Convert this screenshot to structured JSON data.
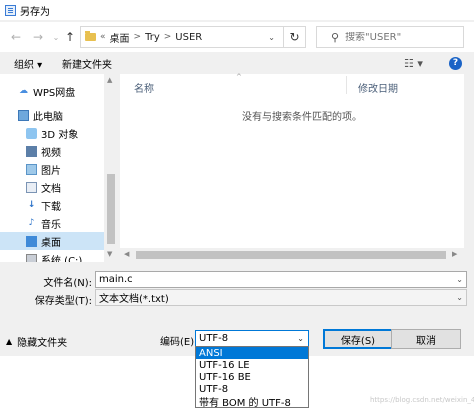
{
  "window": {
    "title": "另存为"
  },
  "address": {
    "overflow": "«",
    "crumbs": [
      "桌面",
      "Try",
      "USER"
    ],
    "separator": ">"
  },
  "search": {
    "placeholder": "搜索\"USER\""
  },
  "toolbar": {
    "organize": "组织 ▾",
    "new_folder": "新建文件夹"
  },
  "nav": {
    "items": [
      {
        "label": "WPS网盘",
        "icon": "cloud-icon"
      },
      {
        "label": "此电脑",
        "icon": "computer-icon"
      },
      {
        "label": "3D 对象",
        "icon": "3d-objects-icon"
      },
      {
        "label": "视频",
        "icon": "video-icon"
      },
      {
        "label": "图片",
        "icon": "pictures-icon"
      },
      {
        "label": "文档",
        "icon": "documents-icon"
      },
      {
        "label": "下载",
        "icon": "download-icon"
      },
      {
        "label": "音乐",
        "icon": "music-icon"
      },
      {
        "label": "桌面",
        "icon": "desktop-icon",
        "selected": true
      },
      {
        "label": "系统 (C:)",
        "icon": "drive-icon"
      }
    ]
  },
  "filelist": {
    "columns": [
      "名称",
      "修改日期"
    ],
    "empty_message": "没有与搜索条件匹配的项。"
  },
  "form": {
    "filename_label": "文件名(N):",
    "filename_value": "main.c",
    "filetype_label": "保存类型(T):",
    "filetype_value": "文本文档(*.txt)",
    "hide_folders": "隐藏文件夹",
    "encoding_label": "编码(E):",
    "encoding_value": "UTF-8",
    "save_button": "保存(S)",
    "cancel_button": "取消"
  },
  "encoding_options": [
    "ANSI",
    "UTF-16 LE",
    "UTF-16 BE",
    "UTF-8",
    "带有 BOM 的 UTF-8"
  ],
  "encoding_highlighted": "ANSI",
  "watermark": "https://blog.csdn.net/weixin_42...",
  "colors": {
    "selection": "#0078d7",
    "nav_selected": "#cce4f7"
  }
}
